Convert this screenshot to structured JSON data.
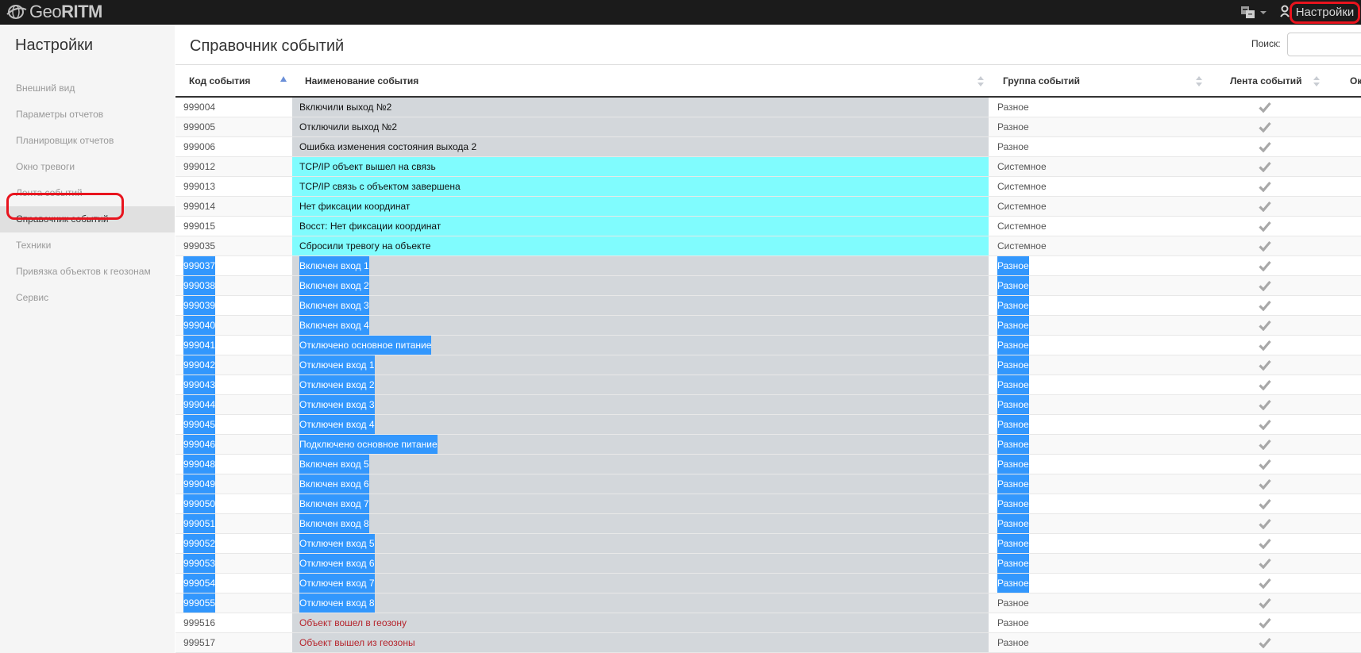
{
  "topbar": {
    "brand_geo": "Geo",
    "brand_ritm": "RITM",
    "settings_label": "Настройки"
  },
  "sidebar": {
    "title": "Настройки",
    "items": [
      {
        "label": "Внешний вид"
      },
      {
        "label": "Параметры отчетов"
      },
      {
        "label": "Планировщик отчетов"
      },
      {
        "label": "Окно тревоги"
      },
      {
        "label": "Лента событий"
      },
      {
        "label": "Справочник событий",
        "active": true
      },
      {
        "label": "Техники"
      },
      {
        "label": "Привязка объектов к геозонам"
      },
      {
        "label": "Сервис"
      }
    ]
  },
  "main": {
    "title": "Справочник событий",
    "search_label": "Поиск:",
    "columns": [
      "Код события",
      "Наименование события",
      "Группа событий",
      "Лента событий",
      "Ок"
    ]
  },
  "rows": [
    {
      "code": "999004",
      "name": "Включили выход №2",
      "group": "Разное",
      "style": "gray",
      "sel": false,
      "selGroup": false
    },
    {
      "code": "999005",
      "name": "Отключили выход №2",
      "group": "Разное",
      "style": "gray",
      "sel": false,
      "selGroup": false
    },
    {
      "code": "999006",
      "name": "Ошибка изменения состояния выхода 2",
      "group": "Разное",
      "style": "gray",
      "sel": false,
      "selGroup": false
    },
    {
      "code": "999012",
      "name": "TCP/IP объект вышел на связь",
      "group": "Системное",
      "style": "cyan",
      "sel": false,
      "selGroup": false
    },
    {
      "code": "999013",
      "name": "TCP/IP связь с объектом завершена",
      "group": "Системное",
      "style": "cyan",
      "sel": false,
      "selGroup": false
    },
    {
      "code": "999014",
      "name": "Нет фиксации координат",
      "group": "Системное",
      "style": "cyan",
      "sel": false,
      "selGroup": false
    },
    {
      "code": "999015",
      "name": "Восст: Нет фиксации координат",
      "group": "Системное",
      "style": "cyan",
      "sel": false,
      "selGroup": false
    },
    {
      "code": "999035",
      "name": "Сбросили тревогу на объекте",
      "group": "Системное",
      "style": "cyan",
      "sel": false,
      "selGroup": false
    },
    {
      "code": "999037",
      "name": "Включен вход 1",
      "group": "Разное",
      "style": "gray",
      "sel": true,
      "selGroup": true
    },
    {
      "code": "999038",
      "name": "Включен вход 2",
      "group": "Разное",
      "style": "gray",
      "sel": true,
      "selGroup": true
    },
    {
      "code": "999039",
      "name": "Включен вход 3",
      "group": "Разное",
      "style": "gray",
      "sel": true,
      "selGroup": true
    },
    {
      "code": "999040",
      "name": "Включен вход 4",
      "group": "Разное",
      "style": "gray",
      "sel": true,
      "selGroup": true
    },
    {
      "code": "999041",
      "name": "Отключено основное питание",
      "group": "Разное",
      "style": "gray",
      "sel": true,
      "selGroup": true
    },
    {
      "code": "999042",
      "name": "Отключен вход 1",
      "group": "Разное",
      "style": "gray",
      "sel": true,
      "selGroup": true
    },
    {
      "code": "999043",
      "name": "Отключен вход 2",
      "group": "Разное",
      "style": "gray",
      "sel": true,
      "selGroup": true
    },
    {
      "code": "999044",
      "name": "Отключен вход 3",
      "group": "Разное",
      "style": "gray",
      "sel": true,
      "selGroup": true
    },
    {
      "code": "999045",
      "name": "Отключен вход 4",
      "group": "Разное",
      "style": "gray",
      "sel": true,
      "selGroup": true
    },
    {
      "code": "999046",
      "name": "Подключено основное питание",
      "group": "Разное",
      "style": "gray",
      "sel": true,
      "selGroup": true
    },
    {
      "code": "999048",
      "name": "Включен вход 5",
      "group": "Разное",
      "style": "gray",
      "sel": true,
      "selGroup": true
    },
    {
      "code": "999049",
      "name": "Включен вход 6",
      "group": "Разное",
      "style": "gray",
      "sel": true,
      "selGroup": true
    },
    {
      "code": "999050",
      "name": "Включен вход 7",
      "group": "Разное",
      "style": "gray",
      "sel": true,
      "selGroup": true
    },
    {
      "code": "999051",
      "name": "Включен вход 8",
      "group": "Разное",
      "style": "gray",
      "sel": true,
      "selGroup": true
    },
    {
      "code": "999052",
      "name": "Отключен вход 5",
      "group": "Разное",
      "style": "gray",
      "sel": true,
      "selGroup": true
    },
    {
      "code": "999053",
      "name": "Отключен вход 6",
      "group": "Разное",
      "style": "gray",
      "sel": true,
      "selGroup": true
    },
    {
      "code": "999054",
      "name": "Отключен вход 7",
      "group": "Разное",
      "style": "gray",
      "sel": true,
      "selGroup": true
    },
    {
      "code": "999055",
      "name": "Отключен вход 8",
      "group": "Разное",
      "style": "gray",
      "sel": true,
      "selGroup": false
    },
    {
      "code": "999516",
      "name": "Объект вошел в геозону",
      "group": "Разное",
      "style": "red",
      "sel": false,
      "selGroup": false
    },
    {
      "code": "999517",
      "name": "Объект вышел из геозоны",
      "group": "Разное",
      "style": "red",
      "sel": false,
      "selGroup": false
    }
  ],
  "colors": {
    "selection": "#3297fd",
    "cyan_row": "#80fcfe",
    "gray_name": "#d3d7db",
    "highlight_outline": "#e8141e",
    "geozone_text": "#b5232b"
  }
}
